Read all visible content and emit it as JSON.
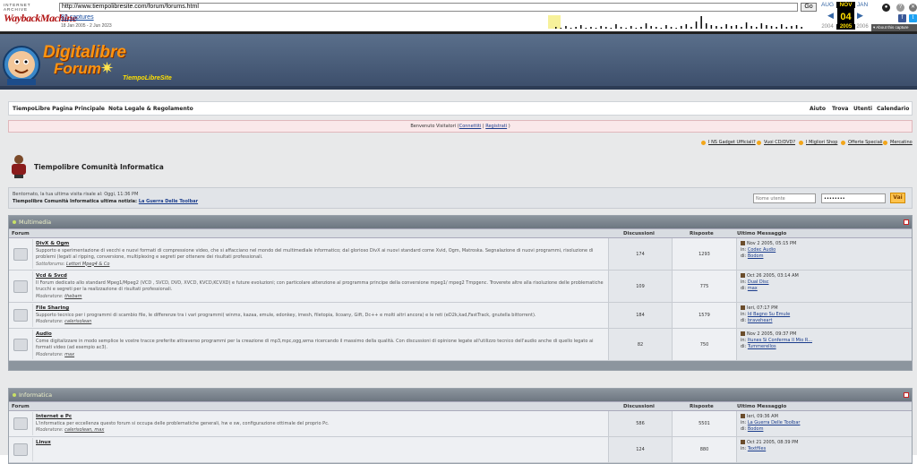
{
  "wayback": {
    "brand_top": "INTERNET ARCHIVE",
    "brand": "WaybackMachine",
    "url": "http://www.tiempolibresite.com/forum/forums.html",
    "go": "Go",
    "captures": "82 captures",
    "range": "18 Jan 2005 - 2 Jun 2023",
    "prev_month": "AUG",
    "cur_month": "NOV",
    "next_month": "JAN",
    "day": "04",
    "prev_year": "2004",
    "cur_year": "2005",
    "next_year": "2006",
    "about": "About this capture"
  },
  "header": {
    "line1": "Digitalibre",
    "line2": "Forum",
    "line3": "TiempoLibreSite"
  },
  "nav": {
    "left": [
      "TiempoLibre Pagina Principale",
      "Nota Legale & Regolamento"
    ],
    "right": [
      "Aiuto",
      "Trova",
      "Utenti",
      "Calendario"
    ]
  },
  "welcome": {
    "text": "Benvenuto Visitatori (",
    "login": "Connettiti",
    "sep": " | ",
    "register": "Registrati",
    "end": " )"
  },
  "links": [
    "I NS Gadget Ufficiali?",
    "Vuoi CD/DVD?",
    "I Migliori Shop",
    "Offerte Speciali",
    "Mercatino"
  ],
  "title": "Tiempolibre Comunità Informatica",
  "info": {
    "line1": "Bentornato, la tua ultima visita risale al: Oggi, 11:36 PM",
    "line2_label": "Tiempolibre Comunità Informatica ultima notizia: ",
    "line2_link": "La Guerra Delle Toolbar",
    "user_placeholder": "Nome utente",
    "pass_value": "••••••••",
    "submit": "Vai"
  },
  "columns": {
    "forum": "Forum",
    "disc": "Discussioni",
    "resp": "Risposte",
    "last": "Ultimo Messaggio"
  },
  "categories": [
    {
      "name": "Multimedia",
      "forums": [
        {
          "title": "DivX & Ogm",
          "desc": "Supporto e sperimentazione di vecchi e nuovi formati di compressione video, che si affacciano nel mondo del multimediale informatico; dal glorioso DivX ai nuovi standard come Xvid, Ogm, Matroska. Segnalazione di nuovi programmi, risoluzione di problemi (legati al ripping, conversione, multiplexing e segreti per ottenere dei risultati professionali.",
          "mod_label": "Sottoforums: ",
          "mod": "Lettori Mpeg4 & Co",
          "disc": "174",
          "resp": "1293",
          "date": "Nov 2 2005, 05:15 PM",
          "in_label": "in: ",
          "in": "Codec Audio",
          "by_label": "di: ",
          "by": "Bodom"
        },
        {
          "title": "Vcd & Svcd",
          "desc": "Il Forum dedicato allo standard Mpeg1/Mpeg2 (VCD , SVCD, DVD, XVCD, KVCD,KCVXD) e future evoluzioni; con particolare attenzione al programma principe della conversione mpeg1/ mpeg2 Tmpgenc. Troverete altre alla risoluzione delle problematiche trucchi e segreti per la realizzazione di risultati professionali.",
          "mod_label": "Moderatore: ",
          "mod": "thebam",
          "disc": "109",
          "resp": "775",
          "date": "Oct 26 2005, 03:14 AM",
          "in_label": "in: ",
          "in": "Dual Disc",
          "by_label": "di: ",
          "by": "max"
        },
        {
          "title": "File Sharing",
          "desc": "Supporto tecnico per i programmi di scambio file, le differenze tra i vari programmi( winmx, kazaa, emule, edonkey, imesh, filetopia, licoany, Gift, Dc++ e molti altri ancora) e le reti (eD2k,kad,FastTrack, gnutella bittorrent).",
          "mod_label": "Moderatore: ",
          "mod": "calerisolean",
          "disc": "184",
          "resp": "1579",
          "date": "Ieri, 07:17 PM",
          "in_label": "in: ",
          "in": "Id Bagno Su Emule",
          "by_label": "di: ",
          "by": "braveheart"
        },
        {
          "title": "Audio",
          "desc": "Come digitalizzare in modo semplice le vostre tracce preferite attraverso programmi per la creazione di mp3,mpc,ogg,wma ricercando il massimo della qualità. Con discussioni di opinione legate all'utilizzo tecnico dell'audio anche di quello legato ai formati video (ad esempio ac3).",
          "mod_label": "Moderatore: ",
          "mod": "max",
          "disc": "82",
          "resp": "750",
          "date": "Nov 2 2005, 09:37 PM",
          "in_label": "in: ",
          "in": "Itunes Si Conferma Il Mio R...",
          "by_label": "di: ",
          "by": "Tummerellos"
        }
      ]
    },
    {
      "name": "Informatica",
      "forums": [
        {
          "title": "Internet e Pc",
          "desc": "L'informatica per eccellenza questo forum si occupa delle problematiche generali, hw e sw, configurazione ottimale del proprio Pc.",
          "mod_label": "Moderatore: ",
          "mod": "calerisolean, max",
          "disc": "586",
          "resp": "5501",
          "date": "Ieri, 09:36 AM",
          "in_label": "in: ",
          "in": "La Guerra Delle Toolbar",
          "by_label": "di: ",
          "by": "Bodom"
        },
        {
          "title": "Linux",
          "desc": "",
          "mod_label": "",
          "mod": "",
          "disc": "124",
          "resp": "880",
          "date": "Oct 21 2005, 08:39 PM",
          "in_label": "in: ",
          "in": "Textfiles",
          "by_label": "",
          "by": ""
        }
      ]
    }
  ]
}
